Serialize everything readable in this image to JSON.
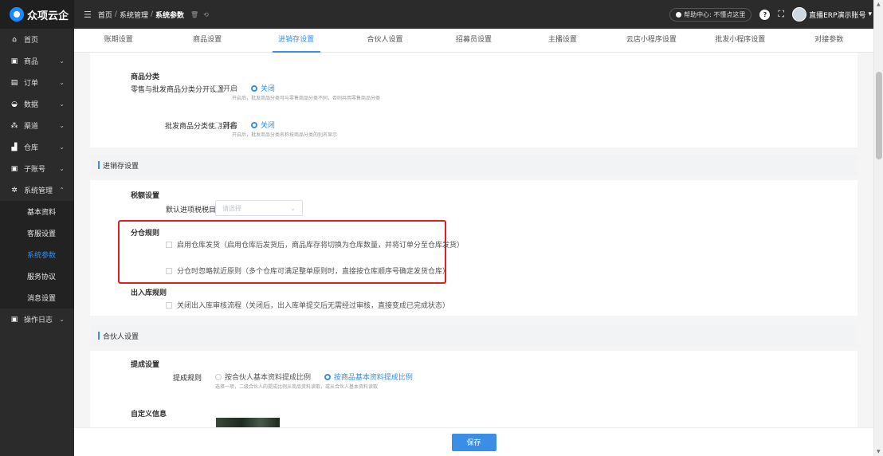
{
  "app": {
    "name": "众项云企"
  },
  "sidebar": {
    "items": [
      {
        "label": "首页",
        "icon": "home-icon",
        "glyph": "⌂",
        "chevron": ""
      },
      {
        "label": "商品",
        "icon": "goods-icon",
        "glyph": "▣",
        "chevron": "⌄"
      },
      {
        "label": "订单",
        "icon": "order-icon",
        "glyph": "▤",
        "chevron": "⌄"
      },
      {
        "label": "数据",
        "icon": "data-icon",
        "glyph": "◒",
        "chevron": "⌄"
      },
      {
        "label": "渠道",
        "icon": "channel-icon",
        "glyph": "⁂",
        "chevron": "⌄"
      },
      {
        "label": "仓库",
        "icon": "warehouse-icon",
        "glyph": "▟",
        "chevron": "⌄"
      },
      {
        "label": "子账号",
        "icon": "subaccount-icon",
        "glyph": "▣",
        "chevron": "⌄"
      },
      {
        "label": "系统管理",
        "icon": "gear-icon",
        "glyph": "✲",
        "chevron": "⌃"
      }
    ],
    "sub_items": [
      {
        "label": "基本资料",
        "active": false
      },
      {
        "label": "客服设置",
        "active": false
      },
      {
        "label": "系统参数",
        "active": true
      },
      {
        "label": "服务协议",
        "active": false
      },
      {
        "label": "消息设置",
        "active": false
      }
    ],
    "log_item": {
      "label": "操作日志",
      "icon": "log-icon",
      "glyph": "▣",
      "chevron": "⌄"
    }
  },
  "topbar": {
    "breadcrumb": [
      "首页",
      "系统管理",
      "系统参数"
    ],
    "separator": "/",
    "help_label": "帮助中心: 不懂点这里",
    "user_label": "直播ERP演示账号"
  },
  "tabs": [
    {
      "label": "账期设置",
      "active": false
    },
    {
      "label": "商品设置",
      "active": false
    },
    {
      "label": "进销存设置",
      "active": true
    },
    {
      "label": "合伙人设置",
      "active": false
    },
    {
      "label": "招募员设置",
      "active": false
    },
    {
      "label": "主播设置",
      "active": false
    },
    {
      "label": "云店小程序设置",
      "active": false
    },
    {
      "label": "批发小程序设置",
      "active": false
    },
    {
      "label": "对接参数",
      "active": false
    }
  ],
  "product_category": {
    "title": "商品分类",
    "row1": {
      "label": "零售与批发商品分类分开设置",
      "opt_on": "开启",
      "opt_off": "关闭",
      "selected": "关闭",
      "hint": "开启后，批发商品分类可与零售商品分类不同，否则共用零售商品分类"
    },
    "row2": {
      "label": "批发商品分类使用别名",
      "opt_on": "开启",
      "opt_off": "关闭",
      "selected": "关闭",
      "hint": "开启后，批发商品分类名称按商品分类的别名显示"
    }
  },
  "inventory": {
    "section_title": "进销存设置",
    "tax_title": "税额设置",
    "tax_label": "默认进项税税目",
    "tax_placeholder": "请选择",
    "split_title": "分仓规则",
    "split_opt1": "启用仓库发货（启用仓库后发货后，商品库存将切换为仓库数量，并将订单分至仓库发货）",
    "split_opt2": "分仓时忽略就近原则（多个仓库可满足整单原则时，直接按仓库顺序号确定发货仓库）",
    "io_title": "出入库规则",
    "io_opt": "关闭出入库审核流程（关闭后，出入库单提交后无需经过审核，直接变成已完成状态）"
  },
  "partner": {
    "section_title": "合伙人设置",
    "commission_title": "提成设置",
    "commission_label": "提成规则",
    "opt1": "按合伙人基本资料提成比例",
    "opt2": "按商品基本资料提成比例",
    "selected": "按商品基本资料提成比例",
    "hint": "选择一项，二级合伙人的提成比例从商品资料读取，或从合伙人基本资料读取",
    "custom_title": "自定义信息"
  },
  "footer": {
    "save_label": "保存"
  },
  "colors": {
    "accent": "#3a8ee6",
    "highlight": "#e02020",
    "sidebar_bg": "#2b2b2b"
  }
}
